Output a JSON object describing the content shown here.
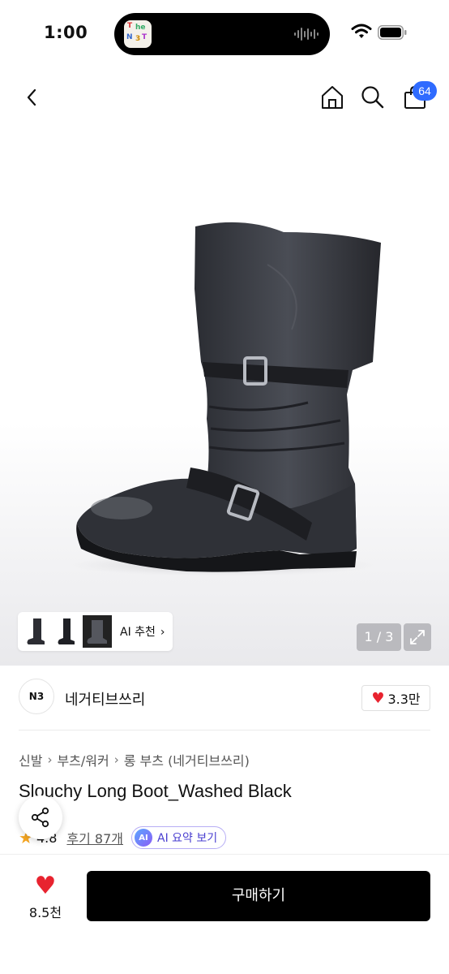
{
  "status_bar": {
    "time": "1:00"
  },
  "nav": {
    "cart_count": "64",
    "back_icon": "chevron-left-icon",
    "home_icon": "home-icon",
    "search_icon": "search-icon",
    "cart_icon": "shopping-bag-icon"
  },
  "gallery": {
    "pager": "1 / 3",
    "ai_recommend_label": "AI 추천"
  },
  "brand": {
    "logo_text": "N3",
    "name": "네거티브쓰리",
    "likes": "3.3만"
  },
  "breadcrumb": [
    "신발",
    "부츠/워커",
    "롱 부츠 (네거티브쓰리)"
  ],
  "product": {
    "title": "Slouchy Long Boot_Washed Black",
    "rating": "4.8",
    "reviews": "후기 87개",
    "ai_summary_chip": "AI",
    "ai_summary_label": "AI 요약 보기"
  },
  "bottom_bar": {
    "wish_count": "8.5천",
    "buy_label": "구매하기"
  },
  "colors": {
    "accent_blue": "#2f6bff",
    "heart_red": "#e8232f",
    "star": "#f5a623",
    "buy_button": "#000000"
  }
}
